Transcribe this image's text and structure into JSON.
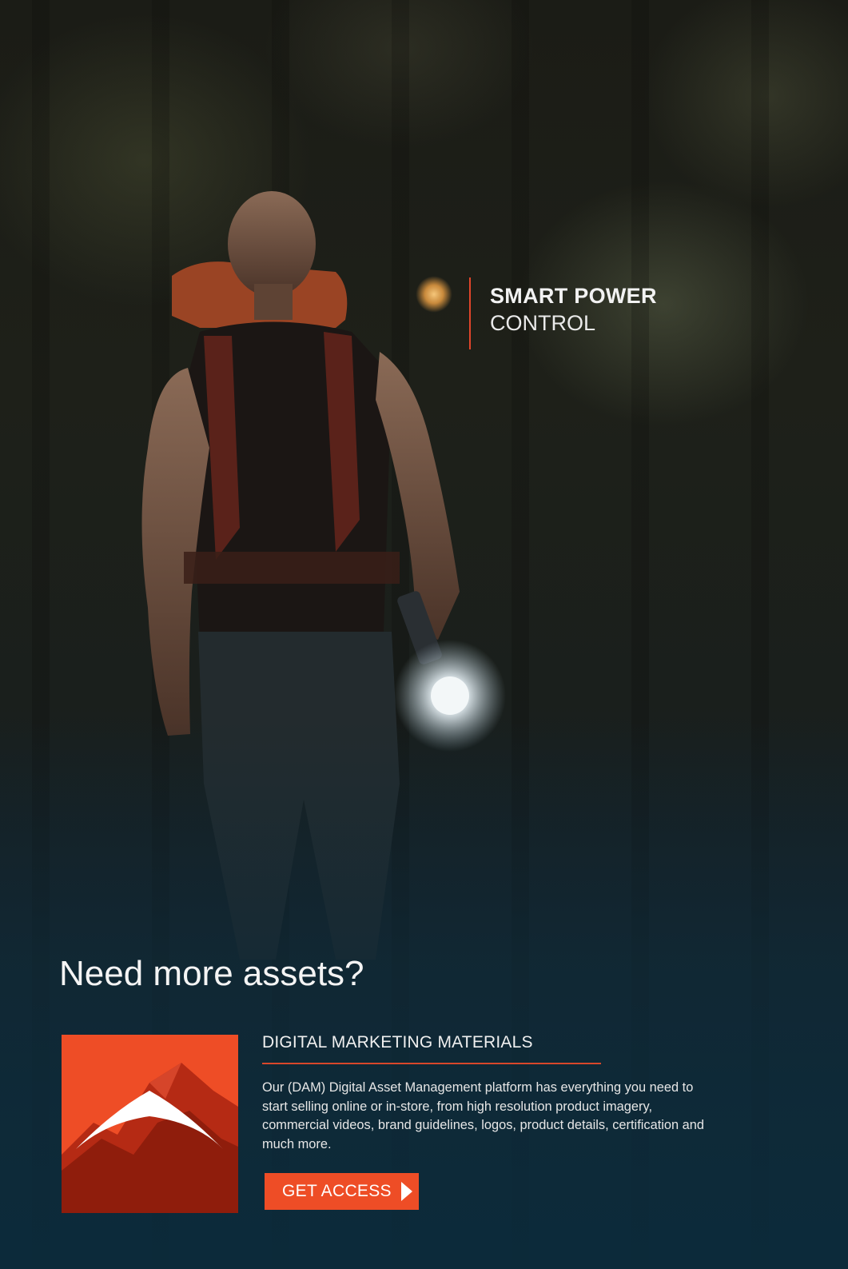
{
  "hero": {
    "tagline_line1": "SMART POWER",
    "tagline_line2": "CONTROL"
  },
  "promo": {
    "heading": "Need more assets?",
    "section_title": "DIGITAL MARKETING MATERIALS",
    "body": "Our (DAM) Digital Asset Management platform has everything you need to start selling online or in-store, from high resolution product imagery, commercial videos, brand guidelines, logos, product details, certification and much more.",
    "cta_label": "GET ACCESS",
    "cta_icon": "play-arrow-icon",
    "logo_icon": "mountain-peak-logo"
  },
  "colors": {
    "accent": "#ee4d26",
    "rule": "#d9472a",
    "background_bottom": "#0d2a3a"
  }
}
